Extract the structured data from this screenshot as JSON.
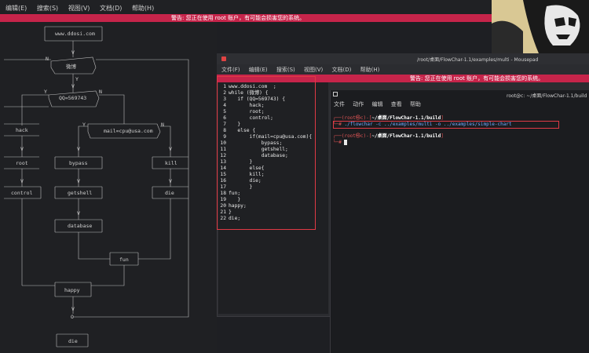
{
  "back_window": {
    "menu": [
      "编辑(E)",
      "搜索(S)",
      "视图(V)",
      "文档(D)",
      "帮助(H)"
    ],
    "warning": "警告: 您正在使用 root 账户，有可能会损害您的系统。"
  },
  "flowchart": {
    "nodes": {
      "site": "www.ddosi.com",
      "weibo": "微博",
      "qq": "QQ=569743",
      "hack": "hack",
      "root": "root",
      "control": "control",
      "mail": "mail=cpu@usa.com",
      "bypass": "bypass",
      "getshell": "getshell",
      "database": "database",
      "kill": "kill",
      "die": "die",
      "fun": "fun",
      "happy": "happy",
      "die2": "die"
    },
    "labels": {
      "n": "N",
      "y": "Y",
      "v": "V",
      "o": "O"
    }
  },
  "mousepad": {
    "title": "/root/桌面/FlowChar-1.1/examples/multi - Mousepad",
    "menu": [
      "文件(F)",
      "编辑(E)",
      "搜索(S)",
      "视图(V)",
      "文档(D)",
      "帮助(H)"
    ],
    "warning": "警告: 您正在使用 root 账户，有可能会损害您的系统。",
    "code": [
      {
        "n": "1",
        "t": "www.ddosi.com  ;"
      },
      {
        "n": "2",
        "t": "while (微博) {"
      },
      {
        "n": "3",
        "t": "   if (QQ=569743) {"
      },
      {
        "n": "4",
        "t": "       hack;"
      },
      {
        "n": "5",
        "t": "       root;"
      },
      {
        "n": "6",
        "t": "       control;"
      },
      {
        "n": "7",
        "t": "   }"
      },
      {
        "n": "8",
        "t": "   else {"
      },
      {
        "n": "9",
        "t": "       if(mail=cpu@usa.com){"
      },
      {
        "n": "10",
        "t": "           bypass;"
      },
      {
        "n": "11",
        "t": "           getshell;"
      },
      {
        "n": "12",
        "t": "           database;"
      },
      {
        "n": "13",
        "t": "       }"
      },
      {
        "n": "14",
        "t": "       else{"
      },
      {
        "n": "15",
        "t": "       kill;"
      },
      {
        "n": "16",
        "t": "       die;"
      },
      {
        "n": "17",
        "t": "       }"
      },
      {
        "n": "18",
        "t": "fun;"
      },
      {
        "n": "19",
        "t": "   }"
      },
      {
        "n": "20",
        "t": "happy;"
      },
      {
        "n": "21",
        "t": "}"
      },
      {
        "n": "22",
        "t": "die;"
      }
    ]
  },
  "terminal": {
    "title": "root@c: ~/桌面/FlowChar-1.1/build",
    "menu": [
      "文件",
      "动作",
      "编辑",
      "查看",
      "帮助"
    ],
    "prompt1": {
      "user": "root",
      "host": "c",
      "path": "~/桌面/FlowChar-1.1/build"
    },
    "command": "./flowchar -c ../examples/multi -o ../examples/simple-chart",
    "prompt2": {
      "user": "root",
      "host": "c",
      "path": "~/桌面/FlowChar-1.1/build"
    }
  },
  "colors": {
    "accent_red": "#e03a45",
    "warning_bg": "#c6244a"
  }
}
